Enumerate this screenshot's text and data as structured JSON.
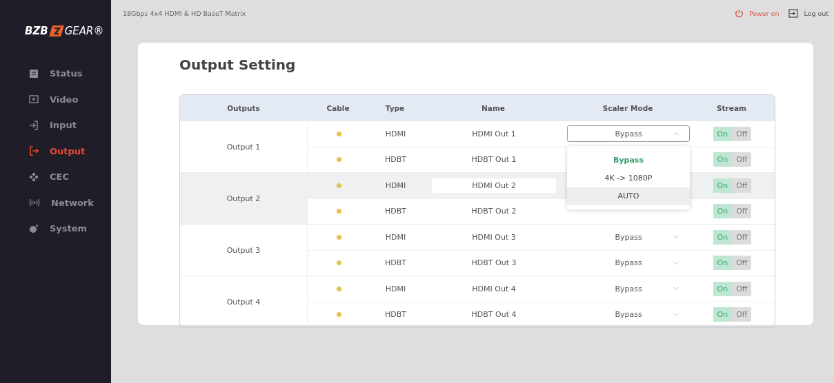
{
  "logo": {
    "left": "BZB",
    "right": "GEAR®"
  },
  "sidebar": {
    "items": [
      {
        "label": "Status",
        "selected": false
      },
      {
        "label": "Video",
        "selected": false
      },
      {
        "label": "Input",
        "selected": false
      },
      {
        "label": "Output",
        "selected": true
      },
      {
        "label": "CEC",
        "selected": false
      },
      {
        "label": "Network",
        "selected": false
      },
      {
        "label": "System",
        "selected": false
      }
    ]
  },
  "header": {
    "product": "18Gbps 4x4 HDMI & HD BaseT Matrix",
    "power": "Power on",
    "logout": "Log out"
  },
  "page": {
    "title": "Output Setting"
  },
  "table": {
    "columns": [
      "Outputs",
      "Cable",
      "Type",
      "Name",
      "Scaler Mode",
      "Stream"
    ],
    "groups": [
      {
        "label": "Output 1",
        "highlighted": false,
        "rows": [
          {
            "color": "#e6c24f",
            "type": "HDMI",
            "name": "HDMI Out 1",
            "editing": false,
            "scaler": "Bypass",
            "open": true,
            "stream": {
              "on": "On",
              "off": "Off",
              "enabled": true
            }
          },
          {
            "color": "#e6c24f",
            "type": "HDBT",
            "name": "HDBT Out 1",
            "editing": false,
            "stream": {
              "on": "On",
              "off": "Off",
              "enabled": true
            }
          }
        ]
      },
      {
        "label": "Output 2",
        "highlighted": true,
        "rows": [
          {
            "color": "#e6c24f",
            "type": "HDMI",
            "name": "HDMI Out 2",
            "editing": true,
            "stream": {
              "on": "On",
              "off": "Off",
              "enabled": true
            }
          },
          {
            "color": "#e6c24f",
            "type": "HDBT",
            "name": "HDBT Out 2",
            "editing": false,
            "stream": {
              "on": "On",
              "off": "Off",
              "enabled": true
            }
          }
        ]
      },
      {
        "label": "Output 3",
        "highlighted": false,
        "rows": [
          {
            "color": "#e6c24f",
            "type": "HDMI",
            "name": "HDMI Out 3",
            "editing": false,
            "scaler": "Bypass",
            "open": false,
            "stream": {
              "on": "On",
              "off": "Off",
              "enabled": true
            }
          },
          {
            "color": "#e6c24f",
            "type": "HDBT",
            "name": "HDBT Out 3",
            "editing": false,
            "scaler": "Bypass",
            "open": false,
            "stream": {
              "on": "On",
              "off": "Off",
              "enabled": true
            }
          }
        ]
      },
      {
        "label": "Output 4",
        "highlighted": false,
        "rows": [
          {
            "color": "#e6c24f",
            "type": "HDMI",
            "name": "HDMI Out 4",
            "editing": false,
            "scaler": "Bypass",
            "open": false,
            "stream": {
              "on": "On",
              "off": "Off",
              "enabled": true
            }
          },
          {
            "color": "#e6c24f",
            "type": "HDBT",
            "name": "HDBT Out 4",
            "editing": false,
            "scaler": "Bypass",
            "open": false,
            "stream": {
              "on": "On",
              "off": "Off",
              "enabled": true
            }
          }
        ]
      }
    ]
  },
  "dropdown": {
    "options": [
      {
        "label": "Bypass",
        "selected": true,
        "hovered": false
      },
      {
        "label": "4K -> 1080P",
        "selected": false,
        "hovered": false
      },
      {
        "label": "AUTO",
        "selected": false,
        "hovered": true
      }
    ]
  }
}
